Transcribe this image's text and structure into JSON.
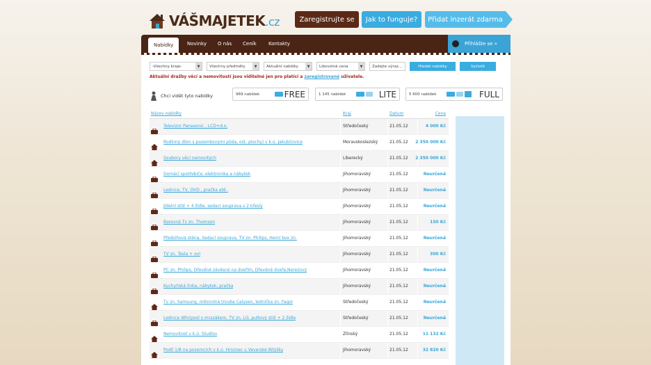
{
  "logo": {
    "main": "VÁŠMAJETEK",
    "tld": ".cz"
  },
  "top_buttons": {
    "register": "Zaregistrujte se",
    "how": "Jak to funguje?",
    "add": "Přidat inzerát zdarma"
  },
  "nav": {
    "items": [
      "Nabídky",
      "Novinky",
      "O nás",
      "Ceník",
      "Kontakty"
    ],
    "user": "Přihlášte se »"
  },
  "filters": {
    "region": "-Všechny kraje-",
    "subject": "Všechny předměty",
    "offers": "Aktuální nabídky",
    "price": "Libovolná cena",
    "search_placeholder": "Zadejte výraz...",
    "search_button": "Hledat nabídky",
    "clear_button": "Vyčistit"
  },
  "notice": {
    "text": "Aktuální dražby věcí a nemovitostí jsou viditelné jen pro platící a",
    "link": "zaregistrované",
    "tail": "uživatele."
  },
  "packages": {
    "label": "Chci vidět tyto nabídky",
    "items": [
      {
        "count": "969 nabídek",
        "name": "FREE"
      },
      {
        "count": "1 145 nabídek",
        "name": "LITE"
      },
      {
        "count": "5 600 nabídek",
        "name": "FULL"
      }
    ]
  },
  "table": {
    "headers": {
      "title": "Název nabídky",
      "region": "Kraj",
      "date": "Datum",
      "price": "Cena"
    },
    "rows": [
      {
        "icon": "briefcase-icon",
        "title": "Televizor Panasonic , LCD+d.o.",
        "region": "Středočeský",
        "date": "21.05.12",
        "price": "4 000 Kč"
      },
      {
        "icon": "house-icon",
        "title": "Rodinný dům s pozemkovými půda, ost. plochy) v k.ú. Jakubčovice",
        "region": "Moravskoslezský",
        "date": "21.05.12",
        "price": "2 350 000 Kč"
      },
      {
        "icon": "house-icon",
        "title": "Soubory věcí nemovitých",
        "region": "Liberecký",
        "date": "21.05.12",
        "price": "2 350 000 Kč"
      },
      {
        "icon": "briefcase-icon",
        "title": "Domácí spotřebiče, elektronika a nábytek",
        "region": "Jihomoravský",
        "date": "21.05.12",
        "price": "Neurčená"
      },
      {
        "icon": "briefcase-icon",
        "title": "Lednice, TV, DVD , pračka atd..",
        "region": "Jihomoravský",
        "date": "21.05.12",
        "price": "Neurčená"
      },
      {
        "icon": "briefcase-icon",
        "title": "Jídelní stůl + 4 židle, sedací souprava s 2 křesly",
        "region": "Jihomoravský",
        "date": "21.05.12",
        "price": "Neurčená"
      },
      {
        "icon": "briefcase-icon",
        "title": "Barevná Tv zn. Thomson",
        "region": "Jihomoravský",
        "date": "21.05.12",
        "price": "150 Kč"
      },
      {
        "icon": "briefcase-icon",
        "title": "Předsíňová stěna, Sedací souprava, TV zn. Philips, Herní box zn.",
        "region": "Jihomoravský",
        "date": "21.05.12",
        "price": "Neurčená"
      },
      {
        "icon": "briefcase-icon",
        "title": "TV zn. Tesla + ovl",
        "region": "Jihomoravský",
        "date": "21.05.12",
        "price": "300 Kč"
      },
      {
        "icon": "briefcase-icon",
        "title": "PC zn. Philips, Dřevěné závěsné na dveřím, Dřevěné dveře,Nerezový",
        "region": "Jihomoravský",
        "date": "21.05.12",
        "price": "Neurčená"
      },
      {
        "icon": "briefcase-icon",
        "title": "Kuchyňská linka, nábytek, pračka",
        "region": "Jihomoravský",
        "date": "21.05.12",
        "price": "Neurčená"
      },
      {
        "icon": "house-icon",
        "title": "Tv zn. Samsung, mikrovlná trouba Calysen, lednička zn. Fagor",
        "region": "Středočeský",
        "date": "21.05.12",
        "price": "Neurčená"
      },
      {
        "icon": "briefcase-icon",
        "title": "Lednice Whirpool s mrazákem, TV zn. LG, pultový stůl + 2 židle",
        "region": "Středočeský",
        "date": "21.05.12",
        "price": "Neurčená"
      },
      {
        "icon": "house-icon",
        "title": "Nemovitost v k.ú. Študlov",
        "region": "Zlínský",
        "date": "21.05.12",
        "price": "11 132 Kč"
      },
      {
        "icon": "house-icon",
        "title": "Podíl 1/8 na pozemcích v k.ú. Hroznec u Veverské Bítýšky",
        "region": "Jihomoravský",
        "date": "21.05.12",
        "price": "32 820 Kč"
      }
    ]
  },
  "colors": {
    "brown": "#4a2415",
    "blue": "#39ace0",
    "red": "#a0281e"
  }
}
